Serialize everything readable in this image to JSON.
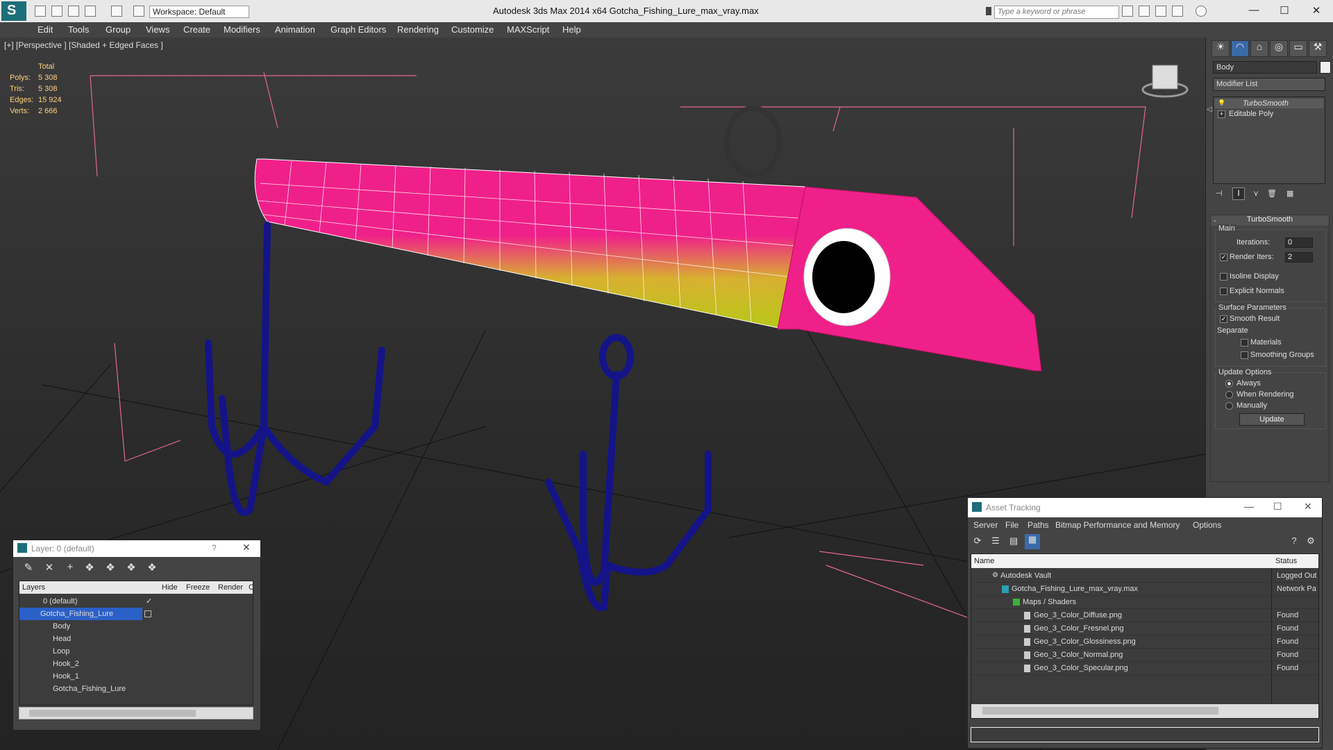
{
  "app": {
    "title": "Autodesk 3ds Max  2014 x64      Gotcha_Fishing_Lure_max_vray.max",
    "workspace": "Workspace: Default",
    "search_placeholder": "Type a keyword or phrase"
  },
  "menu": [
    "Edit",
    "Tools",
    "Group",
    "Views",
    "Create",
    "Modifiers",
    "Animation",
    "Graph Editors",
    "Rendering",
    "Customize",
    "MAXScript",
    "Help"
  ],
  "viewport": {
    "label": "[+] [Perspective ] [Shaded + Edged Faces ]",
    "stats": {
      "header": "Total",
      "rows": [
        {
          "label": "Polys:",
          "value": "5 308"
        },
        {
          "label": "Tris:",
          "value": "5 308"
        },
        {
          "label": "Edges:",
          "value": "15 924"
        },
        {
          "label": "Verts:",
          "value": "2 666"
        }
      ]
    }
  },
  "command_panel": {
    "object_name": "Body",
    "modifier_list": "Modifier List",
    "stack": [
      "TurboSmooth",
      "Editable Poly"
    ],
    "turbosmooth": {
      "title": "TurboSmooth",
      "main_label": "Main",
      "iterations_label": "Iterations:",
      "iterations_value": "0",
      "render_iters_label": "Render Iters:",
      "render_iters_value": "2",
      "render_iters_checked": true,
      "isoline_label": "Isoline Display",
      "explicit_normals_label": "Explicit Normals",
      "surface_params_label": "Surface Parameters",
      "smooth_result_label": "Smooth Result",
      "smooth_result_checked": true,
      "separate_label": "Separate",
      "materials_label": "Materials",
      "smoothing_groups_label": "Smoothing Groups",
      "update_options_label": "Update Options",
      "always_label": "Always",
      "when_rendering_label": "When Rendering",
      "manually_label": "Manually",
      "update_button": "Update"
    }
  },
  "layer_window": {
    "title": "Layer: 0 (default)",
    "columns": [
      "Layers",
      "Hide",
      "Freeze",
      "Render",
      "C"
    ],
    "rows": [
      {
        "name": "0 (default)",
        "indent": 1,
        "selected": false
      },
      {
        "name": "Gotcha_Fishing_Lure",
        "indent": 0,
        "selected": true
      },
      {
        "name": "Body",
        "indent": 2,
        "selected": false
      },
      {
        "name": "Head",
        "indent": 2,
        "selected": false
      },
      {
        "name": "Loop",
        "indent": 2,
        "selected": false
      },
      {
        "name": "Hook_2",
        "indent": 2,
        "selected": false
      },
      {
        "name": "Hook_1",
        "indent": 2,
        "selected": false
      },
      {
        "name": "Gotcha_Fishing_Lure",
        "indent": 2,
        "selected": false
      }
    ]
  },
  "asset_window": {
    "title": "Asset Tracking",
    "menu": [
      "Server",
      "File",
      "Paths",
      "Bitmap Performance and Memory",
      "Options"
    ],
    "columns": [
      "Name",
      "Status"
    ],
    "rows": [
      {
        "name": "Autodesk Vault",
        "status": "Logged Out",
        "indent": 1
      },
      {
        "name": "Gotcha_Fishing_Lure_max_vray.max",
        "status": "Network Pa",
        "indent": 2
      },
      {
        "name": "Maps / Shaders",
        "status": "",
        "indent": 3
      },
      {
        "name": "Geo_3_Color_Diffuse.png",
        "status": "Found",
        "indent": 4
      },
      {
        "name": "Geo_3_Color_Fresnel.png",
        "status": "Found",
        "indent": 4
      },
      {
        "name": "Geo_3_Color_Glossiness.png",
        "status": "Found",
        "indent": 4
      },
      {
        "name": "Geo_3_Color_Normal.png",
        "status": "Found",
        "indent": 4
      },
      {
        "name": "Geo_3_Color_Specular.png",
        "status": "Found",
        "indent": 4
      }
    ]
  },
  "colors": {
    "lure_pink": "#f0208a",
    "lure_yellow": "#c8d020",
    "hook_blue": "#1a1a8a",
    "selection": "#2a60c8"
  }
}
